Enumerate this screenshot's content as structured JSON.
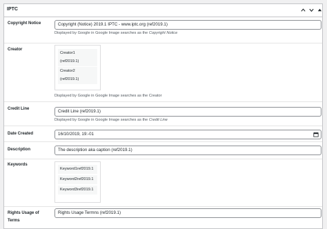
{
  "panel": {
    "title": "IPTC"
  },
  "copyright": {
    "label": "Copyright Notice",
    "value": "Copyright (Notice) 2019.1 IPTC - www.iptc.org  (ref2019.1)",
    "desc_prefix": "Displayed by Google in Google Image searches as the ",
    "desc_em": "Copyright Notice"
  },
  "creator": {
    "label": "Creator",
    "items": [
      {
        "line1": "Creator1",
        "line2": "(ref2019.1)"
      },
      {
        "line1": "Creator2",
        "line2": "(ref2019.1)"
      }
    ],
    "desc": "Displayed by Google in Google Image searches as the Creator"
  },
  "credit": {
    "label": "Credit Line",
    "value": "Credit Line (ref2019.1)",
    "desc_prefix": "Displayed by Google in Google Image searches as the ",
    "desc_em": "Credit Line"
  },
  "date_created": {
    "label": "Date Created",
    "value": "16/10/2019, 19:-01"
  },
  "description": {
    "label": "Description",
    "value": "The description aka caption (ref2019.1)"
  },
  "keywords": {
    "label": "Keywords",
    "items": [
      "Keyword1ref2019.1",
      "Keyword2ref2019.1",
      "Keyword3ref2019.1"
    ]
  },
  "rights": {
    "label_line1": "Rights Usage of",
    "label_line2": "Terms",
    "value": "Rights Usage Termns (ref2019.1)"
  },
  "icons": {
    "move_up": "chevron-up-icon",
    "move_down": "chevron-down-icon",
    "toggle": "triangle-up-icon",
    "calendar": "calendar-icon"
  }
}
